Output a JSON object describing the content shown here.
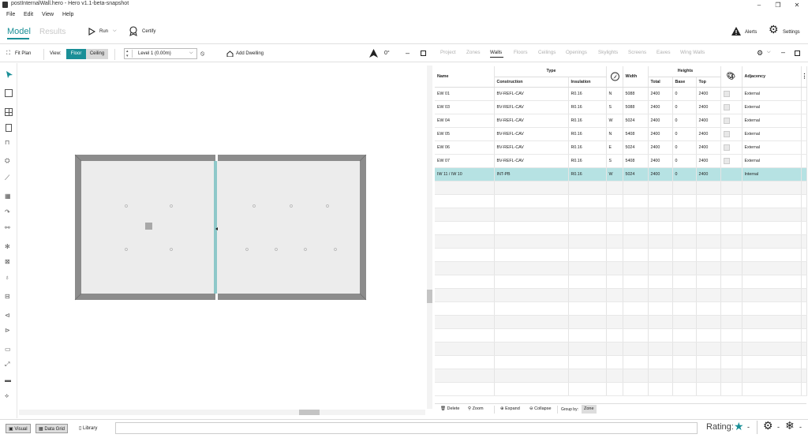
{
  "window": {
    "title": "postInternalWall.hero - Hero v1.1-beta-snapshot"
  },
  "menu": [
    "File",
    "Edit",
    "View",
    "Help"
  ],
  "toolbar": {
    "tab_model": "Model",
    "tab_results": "Results",
    "run": "Run",
    "certify": "Certify",
    "alerts": "Alerts",
    "settings": "Settings"
  },
  "view_toolbar": {
    "fit_plan": "Fit Plan",
    "view_label": "View:",
    "floor": "Floor",
    "ceiling": "Ceiling",
    "level": "Level 1 (0.00m)",
    "add_dwelling": "Add Dwelling",
    "rotation": "0°"
  },
  "panel_tabs": [
    "Project",
    "Zones",
    "Walls",
    "Floors",
    "Ceilings",
    "Openings",
    "Skylights",
    "Screens",
    "Eaves",
    "Wing Walls"
  ],
  "active_tab": "Walls",
  "grid": {
    "headers": {
      "name": "Name",
      "type": "Type",
      "construction": "Construction",
      "insulation": "Insulation",
      "width": "Width",
      "heights": "Heights",
      "total": "Total",
      "base": "Base",
      "top": "Top",
      "adjacency": "Adjacency"
    },
    "rows": [
      {
        "name": "EW 01",
        "construction": "BV-REFL-CAV",
        "insulation": "R0.16",
        "orient": "N",
        "width": "5088",
        "total": "2400",
        "base": "0",
        "top": "2400",
        "adjacency": "External"
      },
      {
        "name": "EW 03",
        "construction": "BV-REFL-CAV",
        "insulation": "R0.16",
        "orient": "S",
        "width": "5088",
        "total": "2400",
        "base": "0",
        "top": "2400",
        "adjacency": "External"
      },
      {
        "name": "EW 04",
        "construction": "BV-REFL-CAV",
        "insulation": "R0.16",
        "orient": "W",
        "width": "5024",
        "total": "2400",
        "base": "0",
        "top": "2400",
        "adjacency": "External"
      },
      {
        "name": "EW 05",
        "construction": "BV-REFL-CAV",
        "insulation": "R0.16",
        "orient": "N",
        "width": "5408",
        "total": "2400",
        "base": "0",
        "top": "2400",
        "adjacency": "External"
      },
      {
        "name": "EW 06",
        "construction": "BV-REFL-CAV",
        "insulation": "R0.16",
        "orient": "E",
        "width": "5024",
        "total": "2400",
        "base": "0",
        "top": "2400",
        "adjacency": "External"
      },
      {
        "name": "EW 07",
        "construction": "BV-REFL-CAV",
        "insulation": "R0.16",
        "orient": "S",
        "width": "5408",
        "total": "2400",
        "base": "0",
        "top": "2400",
        "adjacency": "External"
      },
      {
        "name": "IW 11 / IW 10",
        "construction": "INT-PB",
        "insulation": "R0.16",
        "orient": "W",
        "width": "5024",
        "total": "2400",
        "base": "0",
        "top": "2400",
        "adjacency": "Internal"
      }
    ]
  },
  "grid_footer": {
    "delete": "Delete",
    "zoom": "Zoom",
    "expand": "Expand",
    "collapse": "Collapse",
    "group_by": "Group by:",
    "group_value": "Zone"
  },
  "bottom": {
    "visual": "Visual",
    "data_grid": "Data Grid",
    "library": "Library",
    "rating_label": "Rating:",
    "rating_value": "-",
    "status2": "-",
    "status3": "-"
  },
  "colors": {
    "accent": "#1a8f97",
    "selected_row": "#b6e2e3",
    "wall": "#8c8c8c",
    "room": "#ececec"
  }
}
